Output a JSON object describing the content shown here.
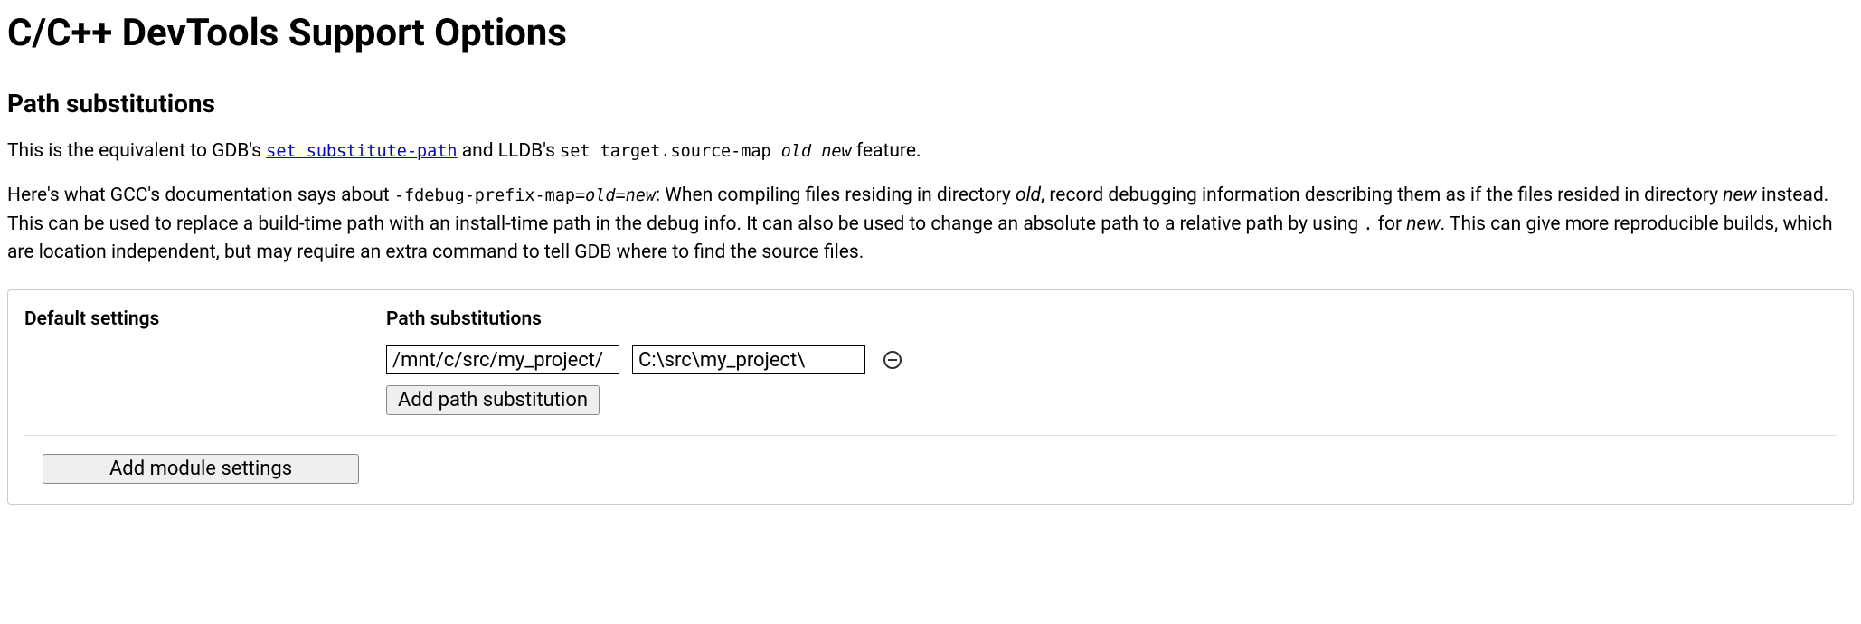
{
  "page": {
    "title": "C/C++ DevTools Support Options",
    "section_heading": "Path substitutions"
  },
  "description": {
    "p1_pre": "This is the equivalent to GDB's ",
    "p1_link": "set substitute-path",
    "p1_mid": " and LLDB's ",
    "p1_code": "set target.source-map ",
    "p1_code_ital": "old new",
    "p1_post": " feature.",
    "p2_pre": "Here's what GCC's documentation says about ",
    "p2_flag_a": "-fdebug-prefix-map=",
    "p2_flag_b": "old=new",
    "p2_mid1": ": When compiling files residing in directory ",
    "p2_old": "old",
    "p2_mid2": ", record debugging information describing them as if the files resided in directory ",
    "p2_new": "new",
    "p2_mid3": " instead. This can be used to replace a build-time path with an install-time path in the debug info. It can also be used to change an absolute path to a relative path by using ",
    "p2_dot": ".",
    "p2_mid4": " for ",
    "p2_new2": "new",
    "p2_post": ". This can give more reproducible builds, which are location independent, but may require an extra command to tell GDB where to find the source files."
  },
  "settings": {
    "default_label": "Default settings",
    "subst_label": "Path substitutions",
    "entries": [
      {
        "from": "/mnt/c/src/my_project/",
        "to": "C:\\src\\my_project\\"
      }
    ],
    "add_substitution_label": "Add path substitution",
    "add_module_label": "Add module settings"
  }
}
